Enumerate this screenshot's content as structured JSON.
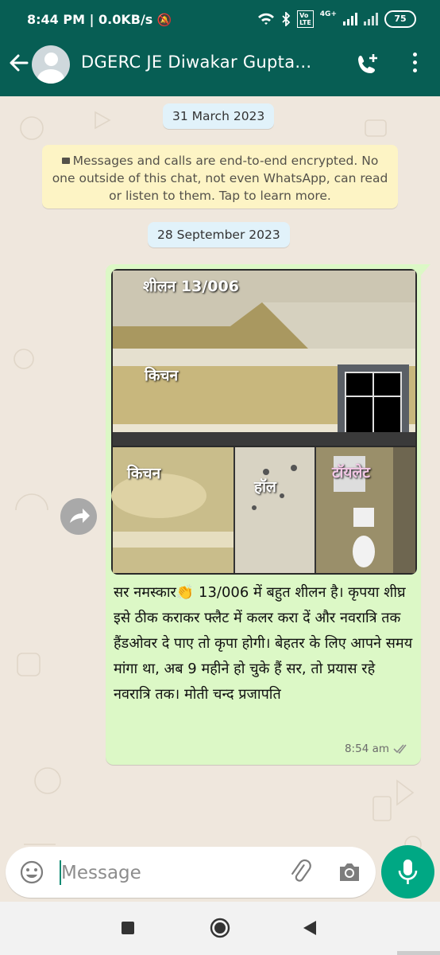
{
  "status_bar": {
    "time": "8:44 PM",
    "speed": "| 0.0KB/s",
    "network": "4G+",
    "battery": "75"
  },
  "header": {
    "contact_name": "DGERC JE Diwakar Gupta...",
    "icons": [
      "back-arrow-icon",
      "avatar",
      "add-call-icon",
      "more-options-icon"
    ]
  },
  "chat": {
    "date_1": "31 March 2023",
    "encryption_notice": "Messages and calls are end-to-end encrypted. No one outside of this chat, not even WhatsApp, can read or listen to them. Tap to learn more.",
    "date_2": "28 September 2023",
    "message": {
      "photo_labels": {
        "top": "शीलन 13/006",
        "kitchen_top": "किचन",
        "kitchen_bottom": "किचन",
        "hall": "हॉल",
        "toilet": "टॉयलेट"
      },
      "text": "सर नमस्कार👏 13/006 में बहुत शीलन है। कृपया शीघ्र इसे ठीक कराकर फ्लैट में कलर करा दें और नवरात्रि तक हैंडओवर दे पाए तो कृपा होगी। बेहतर के लिए आपने समय मांगा था, अब 9 महीने हो चुके हैं सर, तो प्रयास रहे नवरात्रि तक। मोती चन्द प्रजापति",
      "time": "8:54 am",
      "status": "read"
    }
  },
  "composer": {
    "placeholder": "Message"
  },
  "colors": {
    "header": "#075e54",
    "accent": "#00a884",
    "chat_bg": "#efe7dd",
    "outgoing_bubble": "#dcf8c6"
  }
}
